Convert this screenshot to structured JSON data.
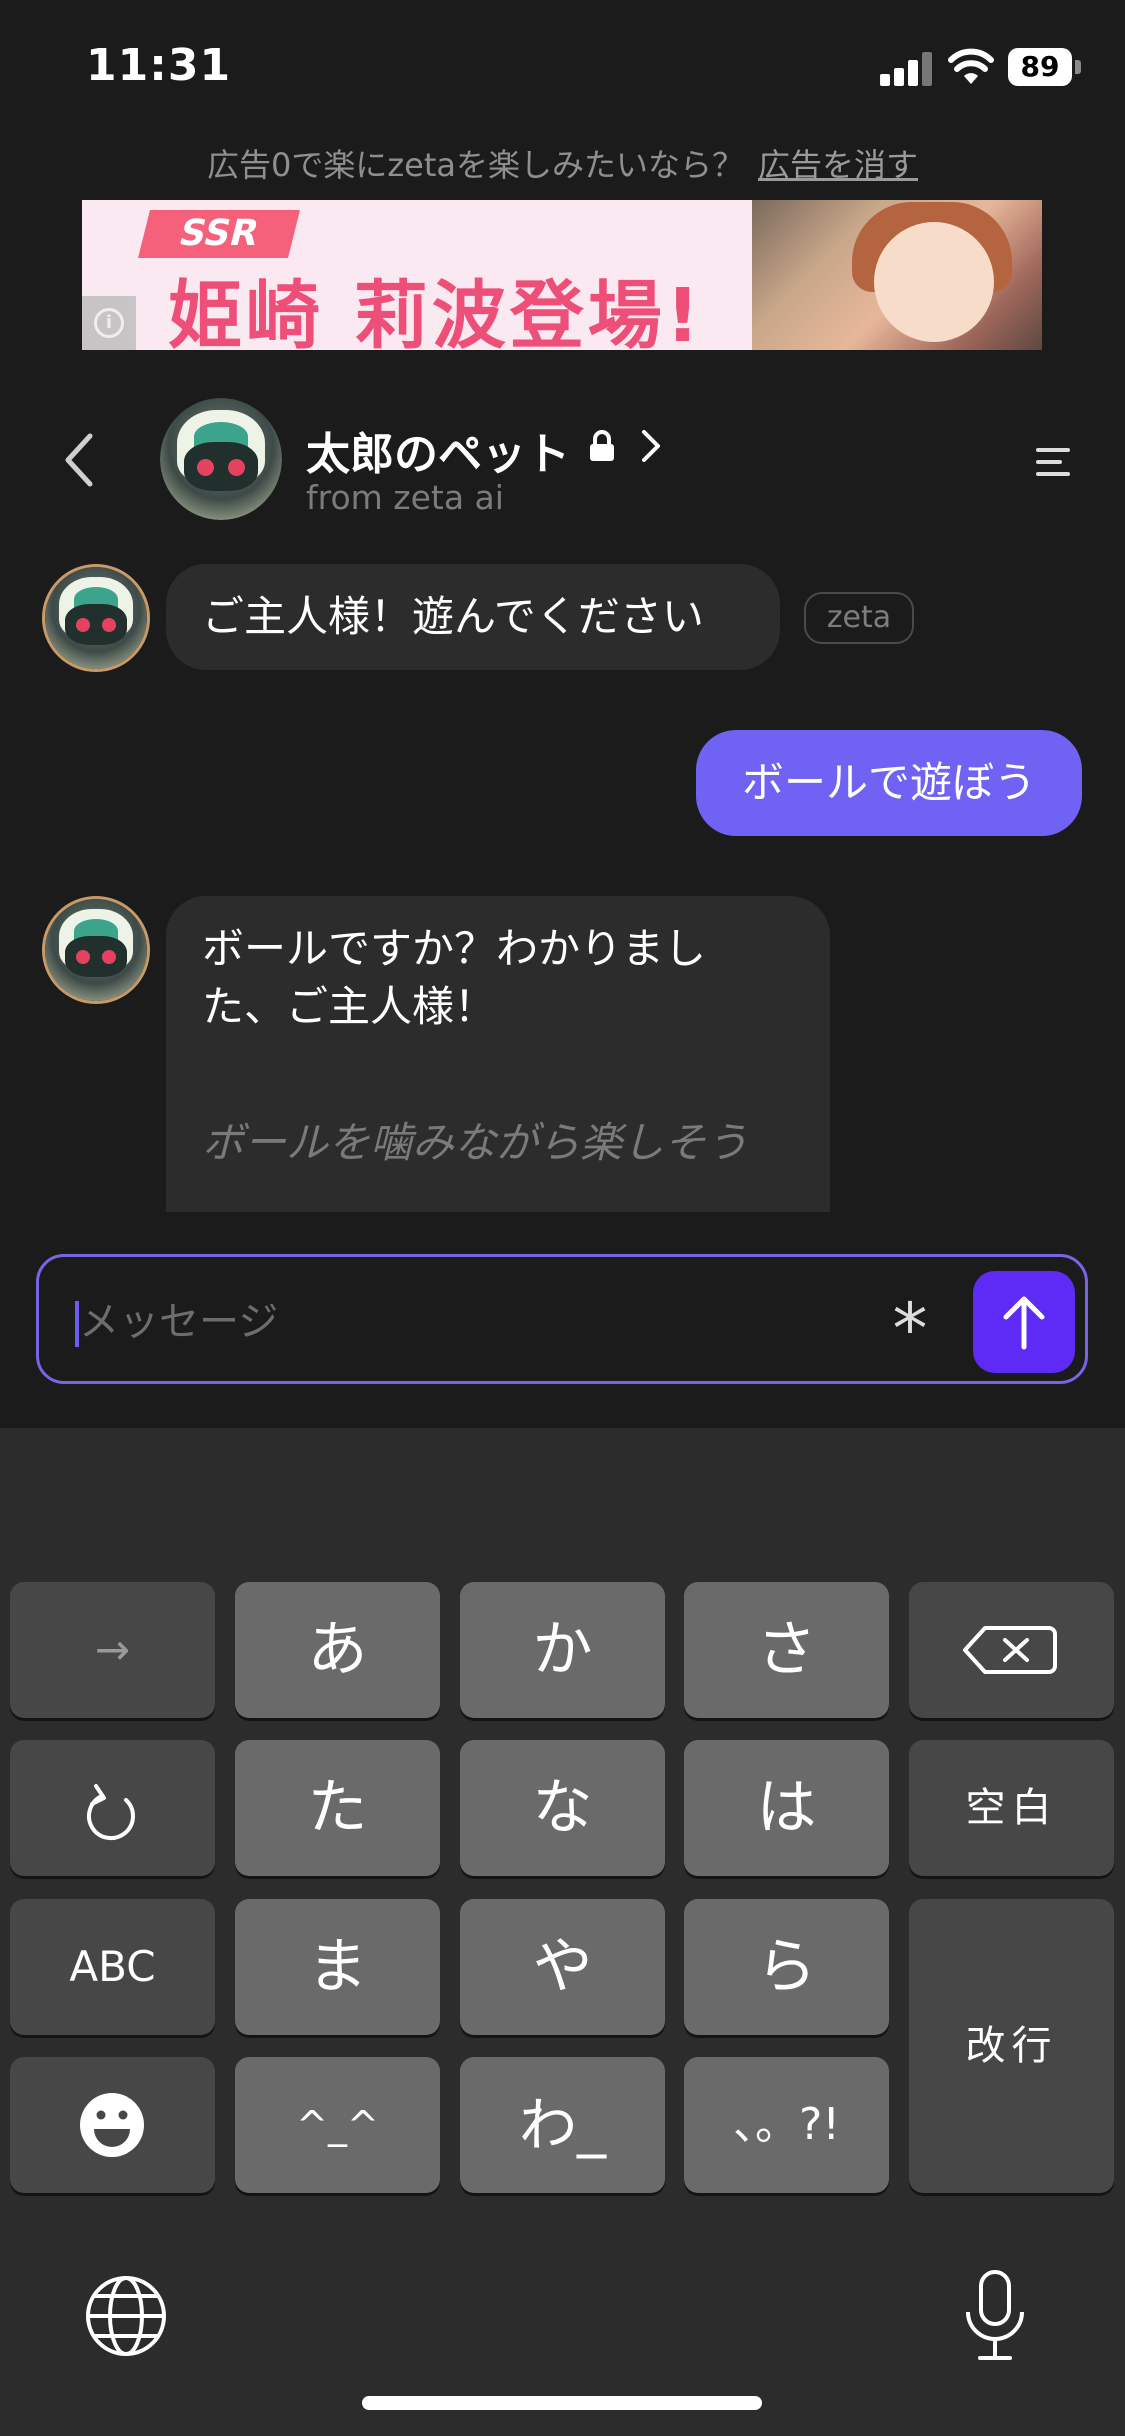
{
  "status_bar": {
    "time": "11:31",
    "battery": "89"
  },
  "ad": {
    "notice": "広告0で楽にzetaを楽しみたいなら？",
    "remove_label": "広告を消す",
    "banner_badge": "SSR",
    "banner_title": "姫崎 莉波登場!"
  },
  "header": {
    "character_name": "太郎のペット",
    "subtitle": "from zeta ai",
    "icons": [
      "back-chevron-icon",
      "lock-icon",
      "chevron-right-icon",
      "menu-icon"
    ]
  },
  "messages": [
    {
      "role": "bot",
      "text": "ご主人様！遊んでください",
      "tag": "zeta"
    },
    {
      "role": "user",
      "text": "ボールで遊ぼう"
    },
    {
      "role": "bot",
      "line1": "ボールですか？わかりまし",
      "line2": "た、ご主人様！",
      "action": "ボールを噛みながら楽しそう"
    }
  ],
  "composer": {
    "placeholder": "メッセージ"
  },
  "keyboard": {
    "row1": [
      "→",
      "あ",
      "か",
      "さ",
      "⌫"
    ],
    "row2": [
      "↺",
      "た",
      "な",
      "は",
      "空白"
    ],
    "row3": [
      "ABC",
      "ま",
      "や",
      "ら"
    ],
    "row4": [
      "☻",
      "^_^",
      "わ_",
      "、。?!"
    ],
    "enter": "改行",
    "bottom": [
      "globe-icon",
      "microphone-icon"
    ]
  },
  "colors": {
    "background": "#1b1b1b",
    "user_bubble": "#7062f2",
    "send_button": "#5d2bf5",
    "bot_bubble": "#2c2c2c"
  }
}
